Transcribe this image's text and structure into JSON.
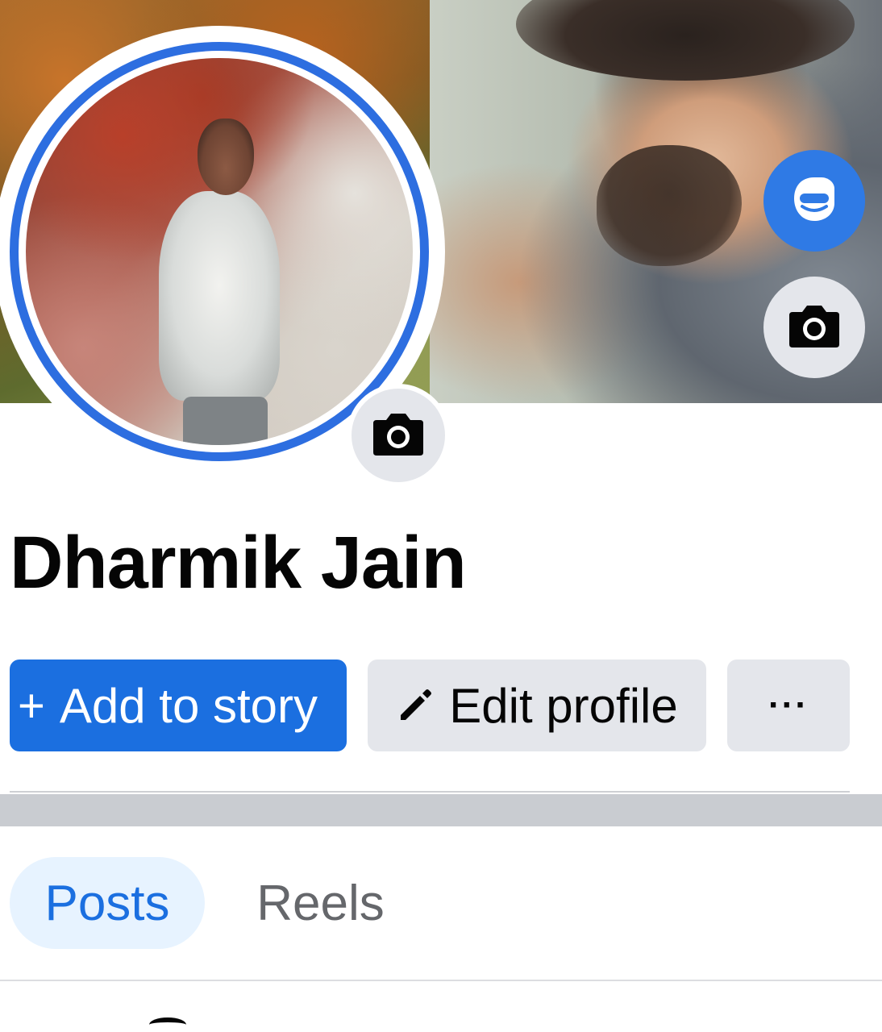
{
  "profile": {
    "name": "Dharmik Jain"
  },
  "actions": {
    "add_story_icon": "+",
    "add_story_label": "Add to story",
    "edit_profile_label": "Edit profile",
    "more_label": "···"
  },
  "tabs": [
    {
      "label": "Posts",
      "selected": true
    },
    {
      "label": "Reels",
      "selected": false
    }
  ],
  "icons": {
    "cover_avatar": "avatar-icon",
    "cover_camera": "camera-icon",
    "profile_camera": "camera-icon",
    "edit": "pencil-icon"
  },
  "colors": {
    "primary_blue": "#1b6fe0",
    "ring_blue": "#2d6ee0",
    "button_gray": "#e4e6eb",
    "tab_selected_bg": "#e7f3ff",
    "tab_inactive_text": "#65676b",
    "text_dark": "#050505"
  }
}
